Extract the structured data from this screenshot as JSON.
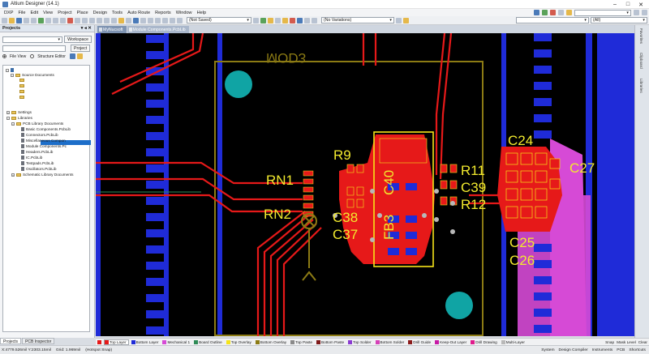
{
  "window": {
    "title": "Altium Designer (14.1)",
    "controls": [
      "–",
      "□",
      "✕"
    ]
  },
  "menu": [
    "DXP",
    "File",
    "Edit",
    "View",
    "Project",
    "Place",
    "Design",
    "Tools",
    "Auto Route",
    "Reports",
    "Window",
    "Help"
  ],
  "toolbar": {
    "not_saved_combo": "(Not Saved)",
    "variations_combo": "(No Variations)",
    "all_combo": "(All)"
  },
  "projects_panel": {
    "title": "Projects",
    "workspace_button": "Workspace",
    "project_button": "Project",
    "file_view": "File View",
    "structure_editor": "Structure Editor",
    "tree": {
      "source_documents": "Source Documents",
      "settings": "Settings",
      "libraries": "Libraries",
      "pcb_library_documents": "PCB Library Documents",
      "pcb_libs": [
        "Basic Components.PcbLib",
        "Connectors.PcbLib",
        "Miscellaneous Compon",
        "Module Components.Pc",
        "Headers.PcbLib",
        "IC.PcbLib",
        "Testpads.PcbLib",
        "Oscillators.PcbLib"
      ],
      "schematic_library_documents": "Schematic Library Documents"
    },
    "tabs": [
      "Projects",
      "PCB Inspector"
    ]
  },
  "document_tabs": [
    "MyNucsoft",
    "Module Components.PcbLib"
  ],
  "right_panel_tabs": [
    "Favorites",
    "Clipboard",
    "Libraries"
  ],
  "pcb": {
    "silkscreen_title": "MOD3",
    "designators": [
      "RN1",
      "RN2",
      "R9",
      "C40",
      "FB3",
      "C38",
      "C37",
      "R11",
      "C39",
      "R12",
      "C24",
      "C27",
      "C25",
      "C26"
    ]
  },
  "layer_tabs": [
    {
      "name": "Top Layer",
      "color": "#e61919",
      "active": true
    },
    {
      "name": "Bottom Layer",
      "color": "#1f2bd8"
    },
    {
      "name": "Mechanical 1",
      "color": "#d64ad6"
    },
    {
      "name": "Board Outline",
      "color": "#2e8b57"
    },
    {
      "name": "Top Overlay",
      "color": "#f5e419"
    },
    {
      "name": "Bottom Overlay",
      "color": "#8c7b14"
    },
    {
      "name": "Top Paste",
      "color": "#8a8a8a"
    },
    {
      "name": "Bottom Paste",
      "color": "#7f1a1a"
    },
    {
      "name": "Top Solder",
      "color": "#8a3ad1"
    },
    {
      "name": "Bottom Solder",
      "color": "#d641b8"
    },
    {
      "name": "Drill Guide",
      "color": "#8b1a1a"
    },
    {
      "name": "Keep-Out Layer",
      "color": "#c71aa6"
    },
    {
      "name": "Drill Drawing",
      "color": "#e01a8c"
    },
    {
      "name": "Multi-Layer",
      "color": "#b8b8b8"
    }
  ],
  "layer_controls": [
    "Snap",
    "Mask Level",
    "Clear"
  ],
  "status": {
    "coords": "X:4779.526mil Y:2303.15mil",
    "grid": "Grid: 1.969mil",
    "snap": "(Hotspot Snap)",
    "right": [
      "System",
      "Design Compiler",
      "Instruments",
      "PCB",
      "Shortcuts"
    ]
  }
}
